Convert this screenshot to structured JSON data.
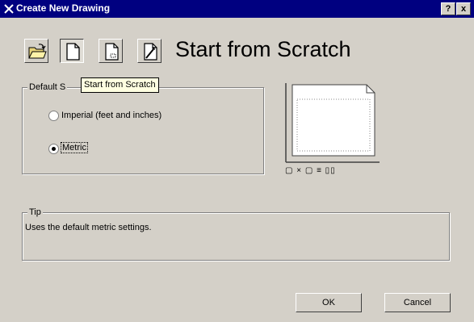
{
  "window": {
    "title": "Create New Drawing",
    "help_label": "?",
    "close_label": "x"
  },
  "toolbar": {
    "buttons": [
      {
        "name": "open-drawing",
        "icon": "open-folder-icon",
        "pressed": false
      },
      {
        "name": "start-from-scratch",
        "icon": "blank-page-icon",
        "pressed": true
      },
      {
        "name": "use-template",
        "icon": "template-page-icon",
        "pressed": false
      },
      {
        "name": "use-wizard",
        "icon": "wizard-icon",
        "pressed": false
      }
    ],
    "heading": "Start from Scratch"
  },
  "tooltip": {
    "text": "Start from Scratch"
  },
  "default_settings": {
    "legend": "Default S",
    "options": [
      {
        "label": "Imperial (feet and inches)",
        "checked": false
      },
      {
        "label": "Metric",
        "checked": true
      }
    ]
  },
  "preview": {
    "indicators": "▢ × ▢    ≡ ▯▯"
  },
  "tip": {
    "legend": "Tip",
    "text": "Uses the default metric settings."
  },
  "buttons": {
    "ok": "OK",
    "cancel": "Cancel"
  },
  "colors": {
    "title_bar": "#000080",
    "dialog_face": "#d4d0c8",
    "tooltip_bg": "#ffffe1"
  }
}
